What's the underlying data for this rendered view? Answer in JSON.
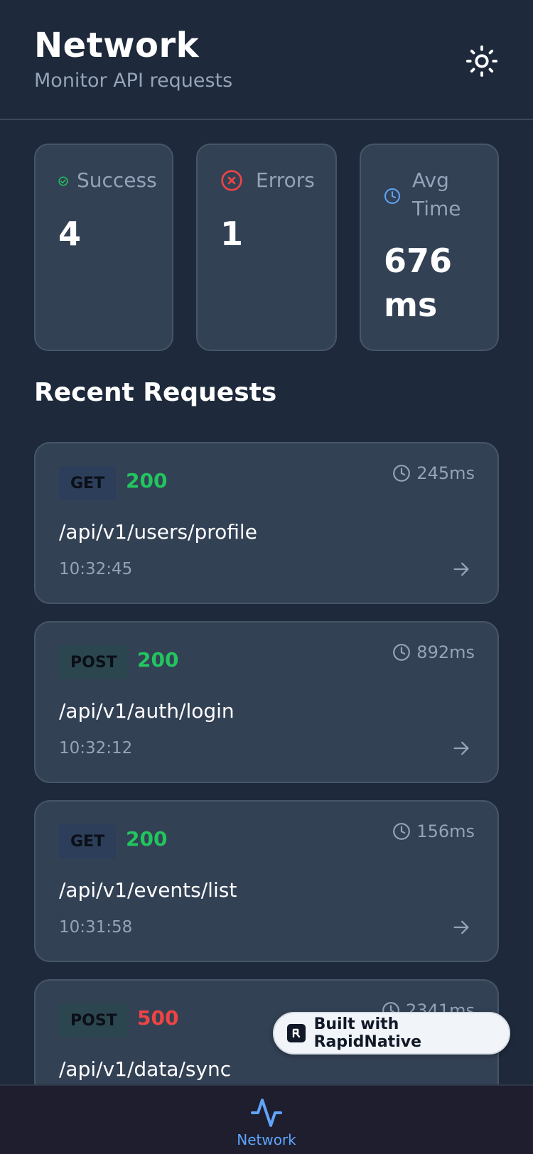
{
  "header": {
    "title": "Network",
    "subtitle": "Monitor API requests",
    "theme_icon": "sun-icon"
  },
  "stats": {
    "success": {
      "label": "Success",
      "value": "4",
      "icon": "check-circle-icon",
      "color": "#22c55e"
    },
    "errors": {
      "label": "Errors",
      "value": "1",
      "icon": "x-circle-icon",
      "color": "#ef4444"
    },
    "avg_time": {
      "label_line1": "Avg",
      "label_line2": "Time",
      "value_line1": "676",
      "value_line2": "ms",
      "icon": "clock-icon",
      "color": "#60a5fa"
    }
  },
  "section_title": "Recent Requests",
  "requests": [
    {
      "method": "GET",
      "status": "200",
      "duration": "245ms",
      "endpoint": "/api/v1/users/profile",
      "time": "10:32:45"
    },
    {
      "method": "POST",
      "status": "200",
      "duration": "892ms",
      "endpoint": "/api/v1/auth/login",
      "time": "10:32:12"
    },
    {
      "method": "GET",
      "status": "200",
      "duration": "156ms",
      "endpoint": "/api/v1/events/list",
      "time": "10:31:58"
    },
    {
      "method": "POST",
      "status": "500",
      "duration": "2341ms",
      "endpoint": "/api/v1/data/sync",
      "time": ""
    }
  ],
  "colors": {
    "success": "#22c55e",
    "error": "#ef4444",
    "get_badge": "#2c3e5a",
    "post_badge": "#2c4650",
    "accent": "#60a5fa"
  },
  "built_with": {
    "label": "Built with RapidNative"
  },
  "bottom_nav": {
    "label": "Network",
    "icon": "activity-icon"
  }
}
